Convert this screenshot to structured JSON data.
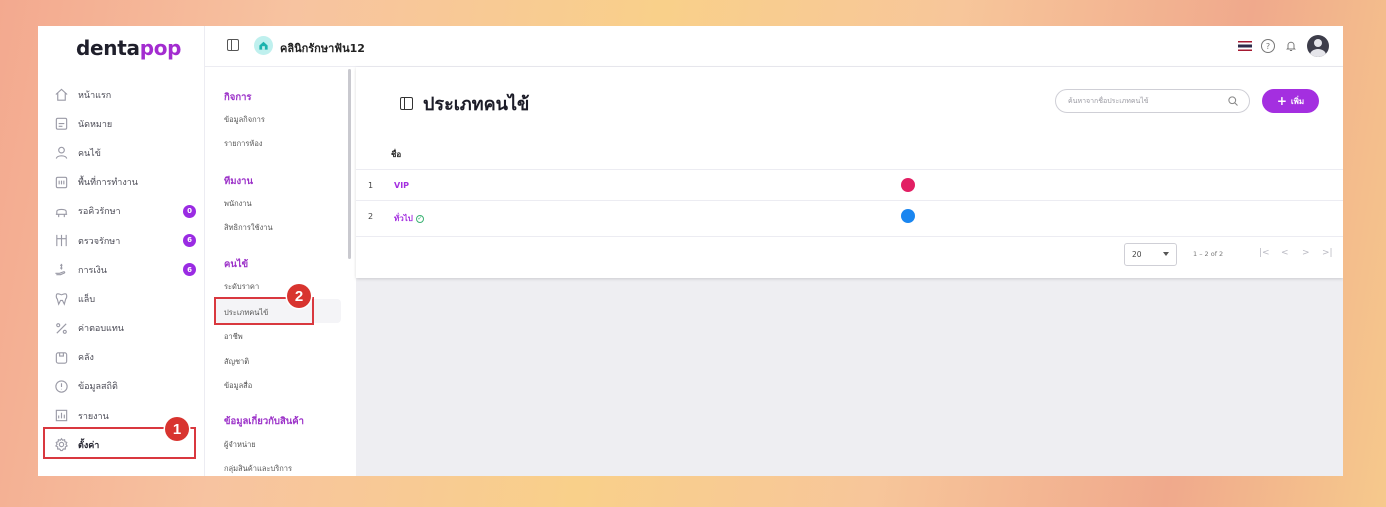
{
  "brand": {
    "name_prefix": "denta",
    "name_suffix": "pop"
  },
  "topbar": {
    "clinic_name": "คลินิกรักษาฟัน12"
  },
  "sidebar": {
    "items": [
      {
        "label": "หน้าแรก",
        "icon": "home-icon"
      },
      {
        "label": "นัดหมาย",
        "icon": "calendar-icon"
      },
      {
        "label": "คนไข้",
        "icon": "user-icon"
      },
      {
        "label": "พื้นที่การทำงาน",
        "icon": "workspace-icon"
      },
      {
        "label": "รอคิวรักษา",
        "icon": "dental-chair-icon",
        "badge": "0"
      },
      {
        "label": "ตรวจรักษา",
        "icon": "treatment-icon",
        "badge": "6"
      },
      {
        "label": "การเงิน",
        "icon": "money-icon",
        "badge": "6"
      },
      {
        "label": "แล็บ",
        "icon": "tooth-icon"
      },
      {
        "label": "ค่าตอบแทน",
        "icon": "percent-icon"
      },
      {
        "label": "คลัง",
        "icon": "inventory-icon"
      },
      {
        "label": "ข้อมูลสถิติ",
        "icon": "stats-icon"
      },
      {
        "label": "รายงาน",
        "icon": "report-icon"
      },
      {
        "label": "ตั้งค่า",
        "icon": "gear-icon"
      }
    ]
  },
  "submenu": {
    "business_title": "กิจการ",
    "business_items": [
      "ข้อมูลกิจการ",
      "รายการห้อง"
    ],
    "team_title": "ทีมงาน",
    "team_items": [
      "พนักงาน",
      "สิทธิการใช้งาน"
    ],
    "patient_title": "คนไข้",
    "patient_items": [
      "ระดับราคา",
      "ประเภทคนไข้",
      "อาชีพ",
      "สัญชาติ",
      "ข้อมูลสื่อ"
    ],
    "product_title": "ข้อมูลเกี่ยวกับสินค้า",
    "product_items": [
      "ผู้จำหน่าย",
      "กลุ่มสินค้าและบริการ"
    ]
  },
  "markers": {
    "one": "1",
    "two": "2"
  },
  "main": {
    "title": "ประเภทคนไข้",
    "search_placeholder": "ค้นหาจากชื่อประเภทคนไข้",
    "add_label": "เพิ่ม",
    "column_name": "ชื่อ",
    "rows": [
      {
        "num": "1",
        "name": "VIP",
        "color": "#e21f63"
      },
      {
        "num": "2",
        "name": "ทั่วไป",
        "color": "#1a86f0",
        "default": true
      }
    ],
    "pagination": {
      "page_size": "20",
      "range": "1 – 2 of 2"
    }
  }
}
